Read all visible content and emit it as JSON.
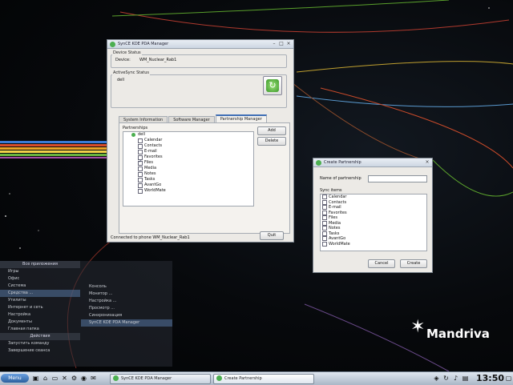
{
  "desktop": {
    "brand": "Mandriva"
  },
  "kde_menu": {
    "header": "Все приложения",
    "left_items": [
      "Игры",
      "Офис",
      "Система",
      "Средства ...",
      "Утилиты",
      "Интернет и сеть",
      "Настройка",
      "Документы",
      "Главная папка"
    ],
    "left_header_2": "Действия",
    "left_items_2": [
      "Запустить команду",
      "Завершение сеанса"
    ],
    "submenu": [
      "Консоль",
      "Монитор ...",
      "Настройка ...",
      "Просмотр ...",
      "Синхронизация",
      "SynCE KDE PDA Manager"
    ]
  },
  "main_window": {
    "title": "SynCE KDE PDA Manager",
    "device_status": {
      "group_label": "Device Status",
      "device_label": "Device:",
      "device_value": "WM_Nuclear_Rab1"
    },
    "activesync": {
      "group_label": "ActiveSync Status",
      "value": "dell"
    },
    "tabs": [
      {
        "label": "System Information",
        "active": false
      },
      {
        "label": "Software Manager",
        "active": false
      },
      {
        "label": "Partnership Manager",
        "active": true
      }
    ],
    "partnerships_label": "Partnerships",
    "partnership_name": "dell",
    "items": [
      {
        "label": "Calendar",
        "checked": false
      },
      {
        "label": "Contacts",
        "checked": false
      },
      {
        "label": "E-mail",
        "checked": false
      },
      {
        "label": "Favorites",
        "checked": false
      },
      {
        "label": "Files",
        "checked": true
      },
      {
        "label": "Media",
        "checked": false
      },
      {
        "label": "Notes",
        "checked": false
      },
      {
        "label": "Tasks",
        "checked": false
      },
      {
        "label": "AvantGo",
        "checked": false
      },
      {
        "label": "WorldMate",
        "checked": false
      }
    ],
    "add_label": "Add",
    "delete_label": "Delete",
    "status_text": "Connected to phone WM_Nuclear_Rab1",
    "quit_label": "Quit"
  },
  "dialog": {
    "title": "Create Partnership",
    "name_label": "Name of partnership",
    "name_value": "",
    "sync_label": "Sync items",
    "items": [
      {
        "label": "Calendar",
        "checked": false
      },
      {
        "label": "Contacts",
        "checked": false
      },
      {
        "label": "E-mail",
        "checked": false
      },
      {
        "label": "Favorites",
        "checked": false
      },
      {
        "label": "Files",
        "checked": false
      },
      {
        "label": "Media",
        "checked": false
      },
      {
        "label": "Notes",
        "checked": false
      },
      {
        "label": "Tasks",
        "checked": false
      },
      {
        "label": "AvantGo",
        "checked": false
      },
      {
        "label": "WorldMate",
        "checked": false
      }
    ],
    "cancel_label": "Cancel",
    "create_label": "Create"
  },
  "taskbar": {
    "start_label": "Menu",
    "tasks": [
      {
        "label": "SynCE KDE PDA Manager",
        "active": false
      },
      {
        "label": "Create Partnership",
        "active": true
      }
    ],
    "clock": "13:50"
  },
  "colors": {
    "accent": "#3f6fb5",
    "sync_green": "#4caf50",
    "taskbar": "#c4cedb"
  }
}
